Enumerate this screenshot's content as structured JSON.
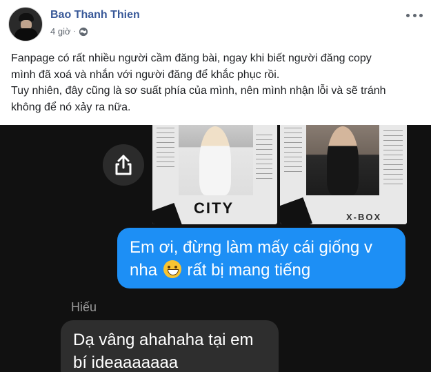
{
  "post": {
    "author": "Bao Thanh Thien",
    "time": "4 giờ",
    "privacy_icon": "globe-icon",
    "more_icon": "more-options-icon",
    "text_lines": [
      "Fanpage có rất nhiều người cầm đăng bài, ngay khi biết người đăng copy",
      "mình đã xoá và nhắn với người đăng để khắc phục rồi.",
      "Tuy nhiên, đây cũng là sơ suất phía của mình, nên mình nhận lỗi và sẽ tránh",
      "không để nó xảy ra nữa."
    ]
  },
  "image": {
    "share_icon": "share-icon",
    "cards": [
      {
        "title": "CITY"
      },
      {
        "title": "X-BOX"
      }
    ],
    "outgoing_message": {
      "line1": "Em ơi, đừng làm mấy cái giống v",
      "line2_before_emoji": "nha",
      "emoji": "grinning-sweat-emoji",
      "line2_after_emoji": "rất bị mang tiếng"
    },
    "incoming_sender": "Hiếu",
    "incoming_message": {
      "line1": "Dạ vâng ahahaha tại em",
      "line2": "bí ideaaaaaaa"
    }
  },
  "colors": {
    "author_link": "#385898",
    "outgoing_bubble": "#1d8ff5",
    "incoming_bubble": "#2e2e2e",
    "chat_background": "#111111"
  }
}
